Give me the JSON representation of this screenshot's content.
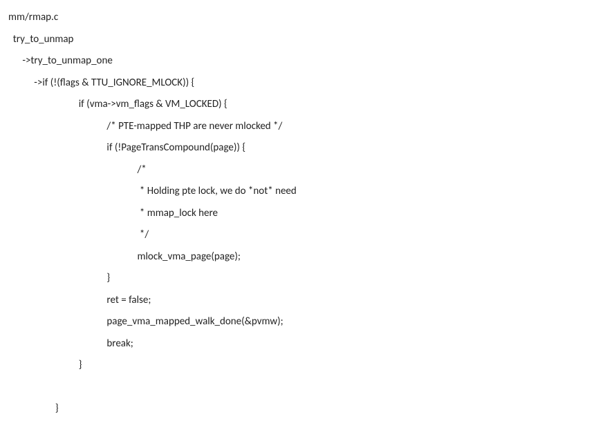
{
  "code": {
    "l1": "mm/rmap.c",
    "l2": "  try_to_unmap",
    "l3": "      ->try_to_unmap_one",
    "l4": "           ->if (!(flags & TTU_IGNORE_MLOCK)) {",
    "l5": "                              if (vma->vm_flags & VM_LOCKED) {",
    "l6": "                                          /* PTE-mapped THP are never mlocked */",
    "l7": "                                          if (!PageTransCompound(page)) {",
    "l8": "                                                       /*",
    "l9": "                                                        * Holding pte lock, we do *not* need",
    "l10": "                                                        * mmap_lock here",
    "l11": "                                                        */",
    "l12": "                                                       mlock_vma_page(page);",
    "l13": "                                          }",
    "l14": "                                          ret = false;",
    "l15": "                                          page_vma_mapped_walk_done(&pvmw);",
    "l16": "                                          break;",
    "l17": "                              }",
    "l18": " ",
    "l19": "                    }"
  }
}
